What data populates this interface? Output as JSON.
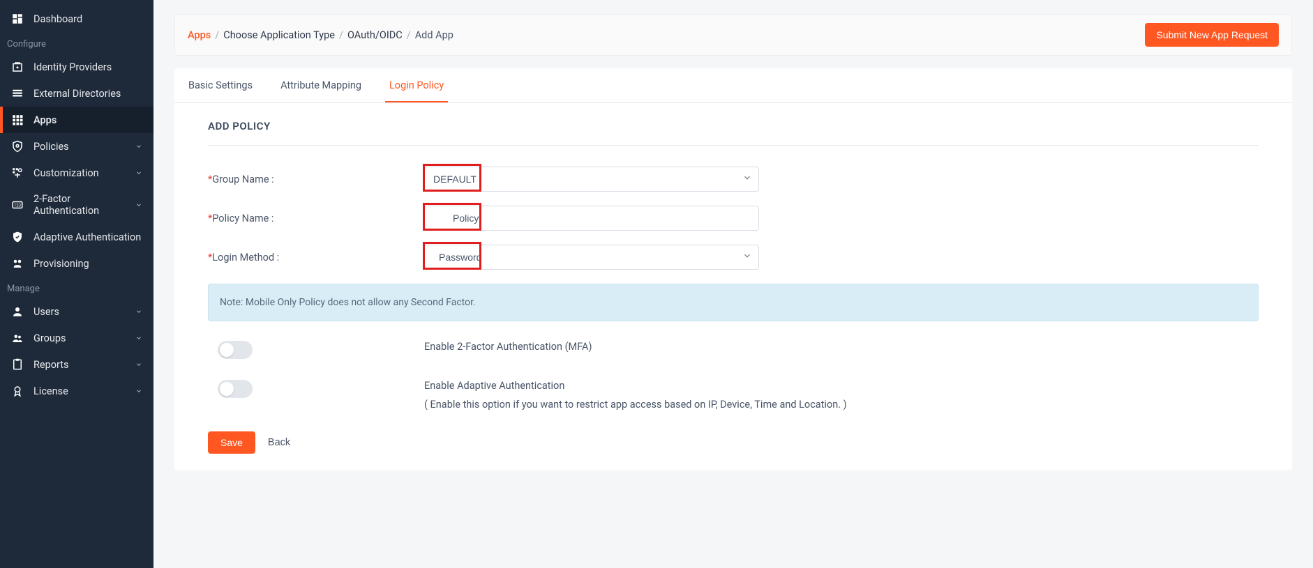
{
  "sidebar": {
    "items": [
      {
        "label": "Dashboard",
        "icon": "dashboard"
      }
    ],
    "sections": [
      {
        "title": "Configure",
        "items": [
          {
            "label": "Identity Providers",
            "icon": "idp",
            "expandable": false
          },
          {
            "label": "External Directories",
            "icon": "directories",
            "expandable": false
          },
          {
            "label": "Apps",
            "icon": "apps",
            "active": true,
            "expandable": false
          },
          {
            "label": "Policies",
            "icon": "policies",
            "expandable": true
          },
          {
            "label": "Customization",
            "icon": "customization",
            "expandable": true
          },
          {
            "label": "2-Factor Authentication",
            "icon": "twofa",
            "expandable": true
          },
          {
            "label": "Adaptive Authentication",
            "icon": "adaptive",
            "expandable": false
          },
          {
            "label": "Provisioning",
            "icon": "provisioning",
            "expandable": false
          }
        ]
      },
      {
        "title": "Manage",
        "items": [
          {
            "label": "Users",
            "icon": "users",
            "expandable": true
          },
          {
            "label": "Groups",
            "icon": "groups",
            "expandable": true
          },
          {
            "label": "Reports",
            "icon": "reports",
            "expandable": true
          },
          {
            "label": "License",
            "icon": "license",
            "expandable": true
          }
        ]
      }
    ]
  },
  "breadcrumb": {
    "items": [
      {
        "label": "Apps"
      },
      {
        "label": "Choose Application Type"
      },
      {
        "label": "OAuth/OIDC"
      }
    ],
    "current": "Add App"
  },
  "header_button": "Submit New App Request",
  "tabs": [
    {
      "label": "Basic Settings",
      "active": false
    },
    {
      "label": "Attribute Mapping",
      "active": false
    },
    {
      "label": "Login Policy",
      "active": true
    }
  ],
  "panel": {
    "title": "ADD POLICY",
    "fields": {
      "group_name": {
        "label": "Group Name :",
        "value": "DEFAULT"
      },
      "policy_name": {
        "label": "Policy Name :",
        "value": "Policy"
      },
      "login_method": {
        "label": "Login Method :",
        "value": "Password"
      }
    },
    "note": "Note: Mobile Only Policy does not allow any Second Factor.",
    "toggles": {
      "mfa": {
        "label": "Enable 2-Factor Authentication (MFA)",
        "on": false
      },
      "adaptive": {
        "label": "Enable Adaptive Authentication",
        "sub": "( Enable this option if you want to restrict app access based on IP, Device, Time and Location. )",
        "on": false
      }
    },
    "actions": {
      "save": "Save",
      "back": "Back"
    }
  }
}
